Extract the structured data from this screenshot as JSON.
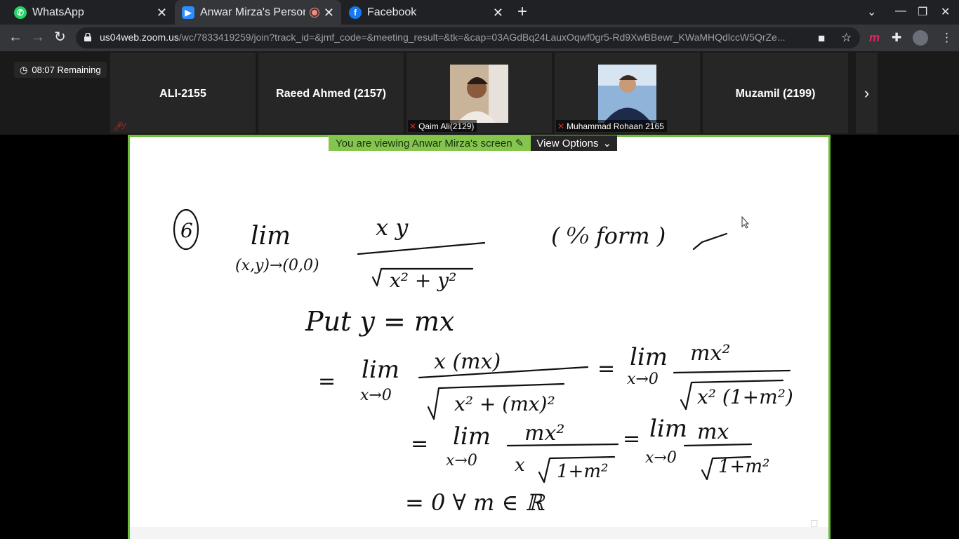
{
  "browser": {
    "tabs": [
      {
        "title": "WhatsApp",
        "icon": "whatsapp-icon",
        "color": "#25d366"
      },
      {
        "title": "Anwar Mirza's Persona",
        "icon": "zoom-icon",
        "color": "#2d8cff",
        "active": true,
        "recording": true
      },
      {
        "title": "Facebook",
        "icon": "facebook-icon",
        "color": "#1877f2"
      }
    ],
    "url_host": "us04web.zoom.us",
    "url_path": "/wc/7833419259/join?track_id=&jmf_code=&meeting_result=&tk=&cap=03AGdBq24LauxOqwf0gr5-Rd9XwBBewr_KWaMHQdlccW5QrZe..."
  },
  "meeting": {
    "timer": "08:07 Remaining",
    "participants": [
      {
        "name": "ALI-2155",
        "muted_label": "",
        "has_photo": false
      },
      {
        "name": "Raeed Ahmed (2157)",
        "muted_label": "",
        "has_photo": false
      },
      {
        "name": "",
        "muted_label": "Qaim Ali(2129)",
        "has_photo": true
      },
      {
        "name": "",
        "muted_label": "Muhammad Rohaan 2165",
        "has_photo": true
      },
      {
        "name": "Muzamil (2199)",
        "muted_label": "",
        "has_photo": false
      }
    ],
    "share_banner": "You are viewing Anwar Mirza's screen",
    "view_options": "View Options"
  },
  "whiteboard": {
    "problem_number": "6",
    "lines": [
      "lim (x,y)→(0,0)  xy / √(x² + y²)     (0/0 form) ✓",
      "Put  y = mx",
      "= lim x→0  x(mx) / √(x² + (mx)²)  =  lim x→0  mx² / √(x²(1+m²))",
      "= lim x→0  mx² / x√(1+m²)  =  lim x→0  mx / √(1+m²)",
      "= 0   ∀ m ∈ ℝ"
    ]
  },
  "colors": {
    "share_border": "#6bbf3a",
    "banner": "#84c64d",
    "mute": "#e02828"
  }
}
